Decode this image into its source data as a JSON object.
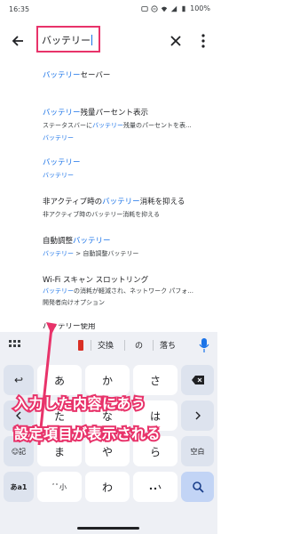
{
  "status": {
    "time": "16:35",
    "battery": "100%"
  },
  "search": {
    "query": "バッテリー"
  },
  "results": [
    {
      "title_hl": "バッテリー",
      "title_rest": "セーバー"
    },
    {
      "title_hl": "バッテリー",
      "title_rest": "残量パーセント表示",
      "sub_pre": "ステータスバーに",
      "sub_hl": "バッテリー",
      "sub_post": "残量のパーセントを表...",
      "path": "バッテリー"
    },
    {
      "title_hl": "バッテリー",
      "path": "バッテリー"
    },
    {
      "title_pre": "非アクティブ時の",
      "title_hl": "バッテリー",
      "title_rest": "消耗を抑える",
      "sub": "非アクティブ時のバッテリー消耗を抑える"
    },
    {
      "title_pre": "自動調整",
      "title_hl": "バッテリー",
      "path_hl": "バッテリー",
      "path_rest": " > 自動調整バッテリー"
    },
    {
      "title": "Wi-Fi スキャン スロットリング",
      "sub_hl": "バッテリー",
      "sub_post": "の消耗が軽減され、ネットワーク パフォ...",
      "sub2": "開発者向けオプション"
    },
    {
      "partial": "バッテリー使用"
    }
  ],
  "keyboard": {
    "toolbar": [
      "交換",
      "の",
      "落ち"
    ],
    "rows": [
      [
        "あ",
        "か",
        "さ"
      ],
      [
        "た",
        "な",
        "は"
      ],
      [
        "ま",
        "や",
        "ら"
      ],
      [
        "",
        "わ",
        ""
      ]
    ],
    "left_keys": [
      "↩",
      "",
      "☺記",
      "あa1"
    ],
    "space_label": "空白",
    "small_dakuten": "ﾞﾟ小"
  },
  "annotation": {
    "line1": "入力した内容にあう",
    "line2": "設定項目が表示される",
    "accent": "#e8336a"
  },
  "colors": {
    "highlight": "#1a73e8",
    "accent": "#e8336a"
  }
}
